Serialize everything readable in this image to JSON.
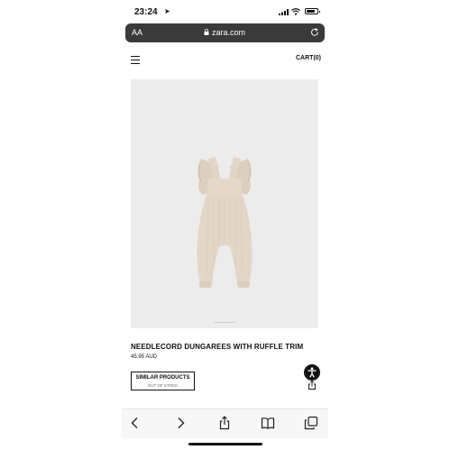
{
  "status_bar": {
    "time": "23:24"
  },
  "browser": {
    "text_size_label": "AA",
    "url": "zara.com"
  },
  "site_header": {
    "cart_label": "CART(0)"
  },
  "product": {
    "title": "NEEDLECORD DUNGAREES WITH RUFFLE TRIM",
    "price": "45.95 AUD",
    "similar_button_label": "SIMILAR PRODUCTS",
    "stock_status": "OUT OF STOCK"
  },
  "icons": {
    "status": [
      "location-icon",
      "signal-icon",
      "wifi-icon",
      "battery-icon"
    ],
    "browser": [
      "lock-icon",
      "reload-icon"
    ],
    "page": [
      "menu-icon",
      "accessibility-icon",
      "share-icon"
    ],
    "toolbar": [
      "back-icon",
      "forward-icon",
      "share-icon",
      "bookmarks-icon",
      "tabs-icon"
    ]
  },
  "colors": {
    "url_bar": "#3a3a3a",
    "image_bg": "#ececec",
    "product": "#e3d6c8",
    "text": "#111111"
  }
}
